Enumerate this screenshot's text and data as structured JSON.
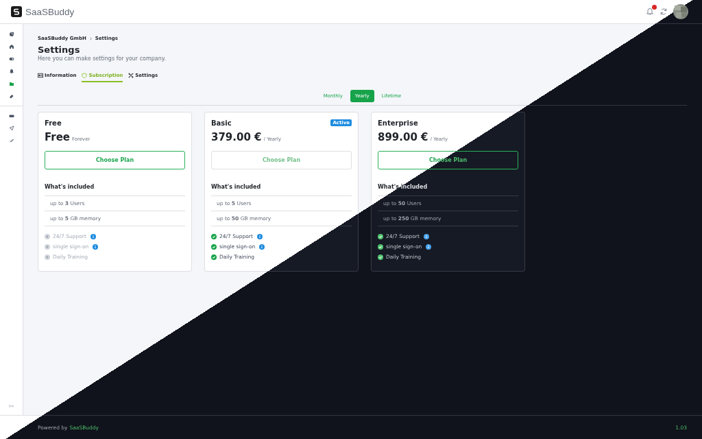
{
  "header": {
    "brand": "SaaSBuddy",
    "notifications": true
  },
  "sidebar": {
    "groups": [
      [
        {
          "selected": false
        },
        {
          "selected": false
        },
        {
          "selected": false
        },
        {
          "selected": false
        },
        {
          "selected": true
        },
        {
          "selected": false
        }
      ],
      [
        {
          "selected": false
        },
        {
          "selected": false
        },
        {
          "selected": false
        }
      ]
    ]
  },
  "breadcrumb": [
    "SaaSBuddy GmbH",
    "Settings"
  ],
  "title": "Settings",
  "subtitle": "Here you can make settings for your company.",
  "tabs": [
    {
      "label": "Information",
      "selected": false
    },
    {
      "label": "Subscription",
      "selected": true
    },
    {
      "label": "Settings",
      "selected": false
    }
  ],
  "billing_periods": [
    {
      "label": "Monthly",
      "selected": false
    },
    {
      "label": "Yearly",
      "selected": true
    },
    {
      "label": "Lifetime",
      "selected": false
    }
  ],
  "plans": [
    {
      "name": "Free",
      "price": "Free",
      "period": "Forever",
      "button": {
        "label": "Choose Plan",
        "disabled": false
      },
      "included_heading": "What's included",
      "limits": [
        "up to **3** Users",
        "up to **5** GB memory"
      ],
      "features": [
        {
          "label": "24/7 Support",
          "included": false,
          "info": true
        },
        {
          "label": "single sign-on",
          "included": false,
          "info": true
        },
        {
          "label": "Daily Training",
          "included": false
        }
      ]
    },
    {
      "name": "Basic",
      "price": "379.00 €",
      "period": "/ Yearly",
      "badge": "Active",
      "button": {
        "label": "Choose Plan",
        "disabled": true
      },
      "included_heading": "What's included",
      "limits": [
        "up to **5** Users",
        "up to **50** GB memory"
      ],
      "features": [
        {
          "label": "24/7 Support",
          "included": true,
          "info": true
        },
        {
          "label": "single sign-on",
          "included": true,
          "info": true
        },
        {
          "label": "Daily Training",
          "included": true
        }
      ]
    },
    {
      "name": "Enterprise",
      "price": "899.00 €",
      "period": "/ Yearly",
      "button": {
        "label": "Choose Plan",
        "disabled": false
      },
      "included_heading": "What's included",
      "limits": [
        "up to **50** Users",
        "up to **250** GB memory"
      ],
      "features": [
        {
          "label": "24/7 Support",
          "included": true,
          "info": true
        },
        {
          "label": "single sign-on",
          "included": true,
          "info": true
        },
        {
          "label": "Daily Training",
          "included": true
        }
      ]
    }
  ],
  "footer": {
    "powered_by": "Powered by",
    "brand_link": "SaaSBuddy",
    "version": "1.03"
  }
}
